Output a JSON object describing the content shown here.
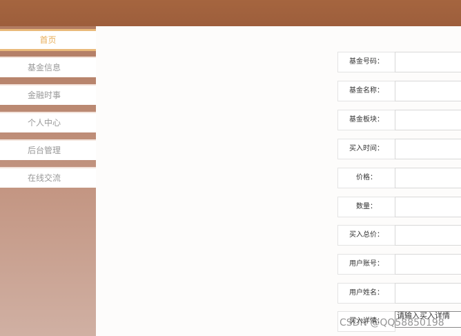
{
  "nav": {
    "items": [
      {
        "label": "首页",
        "active": true
      },
      {
        "label": "基金信息",
        "active": false
      },
      {
        "label": "金融时事",
        "active": false
      },
      {
        "label": "个人中心",
        "active": false
      },
      {
        "label": "后台管理",
        "active": false
      },
      {
        "label": "在线交流",
        "active": false
      }
    ]
  },
  "form": {
    "fund_code_label": "基金号码：",
    "fund_name_label": "基金名称：",
    "fund_sector_label": "基金板块：",
    "buy_time_label": "买入时间：",
    "price_label": "价格：",
    "quantity_label": "数量：",
    "total_price_label": "买入总价：",
    "user_account_label": "用户账号：",
    "user_name_label": "用户姓名：",
    "buy_details_label": "买入详情：",
    "buy_details_placeholder": "请输入买入详情"
  },
  "watermark": "CSDN @QQ58850198",
  "colors": {
    "header": "#a5653f",
    "sidebar_top": "#b27c62",
    "sidebar_bottom": "#d0b0a3",
    "active_nav": "#e8ae5a"
  }
}
